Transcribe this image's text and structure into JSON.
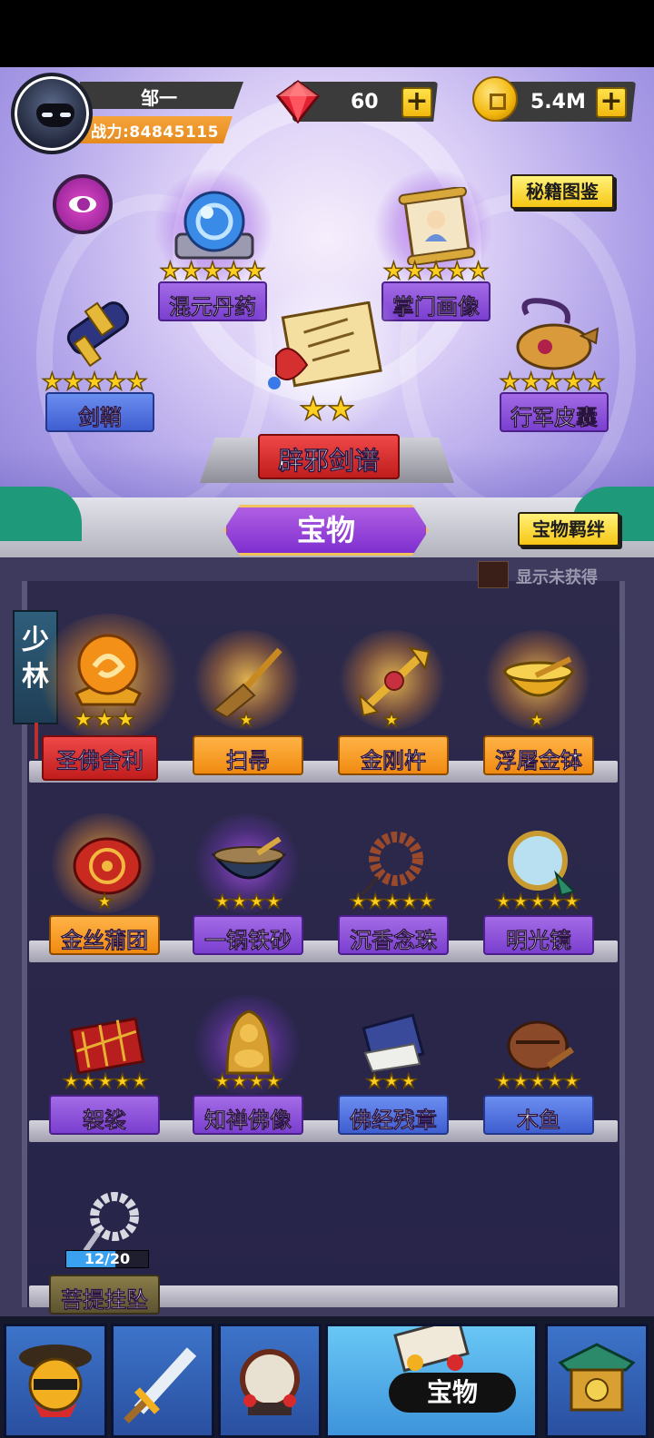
{
  "player": {
    "name": "邹一",
    "power": "战力:84845115"
  },
  "currency": {
    "gems": {
      "value": "60",
      "plus": "+"
    },
    "gold": {
      "value": "5.4M",
      "plus": "+"
    }
  },
  "header_buttons": {
    "codex": "秘籍图鉴",
    "bonds": "宝物羁绊"
  },
  "equipped": [
    {
      "name": "混元丹药",
      "stars": 5,
      "style": "purple"
    },
    {
      "name": "掌门画像",
      "stars": 5,
      "style": "purple"
    },
    {
      "name": "剑鞘",
      "stars": 5,
      "style": "blue"
    },
    {
      "name": "行军皮囊",
      "stars": 5,
      "style": "purple"
    },
    {
      "name": "辟邪剑谱",
      "stars": 2,
      "style": "red"
    }
  ],
  "section_title": "宝物",
  "show_unowned_label": "显示未获得",
  "sect_tag": "少林",
  "items": [
    {
      "name": "圣佛舍利",
      "stars": 3,
      "style": "red"
    },
    {
      "name": "扫帚",
      "stars": 1,
      "style": "orange"
    },
    {
      "name": "金刚杵",
      "stars": 1,
      "style": "orange"
    },
    {
      "name": "浮屠金钵",
      "stars": 1,
      "style": "orange"
    },
    {
      "name": "金丝蒲团",
      "stars": 1,
      "style": "orange"
    },
    {
      "name": "一锅铁砂",
      "stars": 4,
      "style": "purple"
    },
    {
      "name": "沉香念珠",
      "stars": 5,
      "style": "purple"
    },
    {
      "name": "明光镜",
      "stars": 5,
      "style": "purple"
    },
    {
      "name": "袈裟",
      "stars": 5,
      "style": "purple"
    },
    {
      "name": "知禅佛像",
      "stars": 4,
      "style": "purple"
    },
    {
      "name": "佛经残章",
      "stars": 3,
      "style": "blue"
    },
    {
      "name": "木鱼",
      "stars": 5,
      "style": "blue"
    },
    {
      "name": "菩提挂坠",
      "stars": 0,
      "style": "bronze",
      "progress_text": "12/20",
      "progress_current": 12,
      "progress_total": 20
    }
  ],
  "nav": {
    "active_label": "宝物"
  },
  "colors": {
    "star": "#ffcf1f",
    "purple": "#7a3fcf",
    "gold_button": "#f7c615",
    "panel": "#2d2a4b"
  }
}
